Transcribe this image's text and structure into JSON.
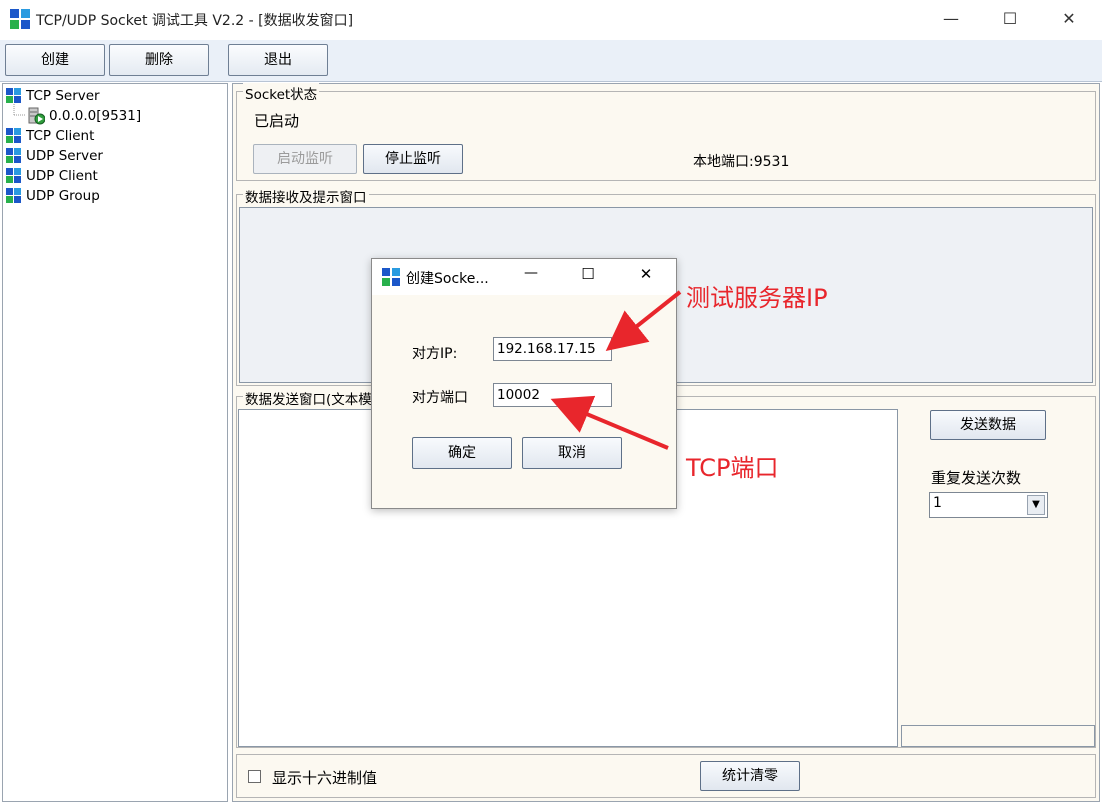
{
  "window": {
    "title": "TCP/UDP Socket 调试工具 V2.2 - [数据收发窗口]",
    "minimize_label": "—",
    "maximize_label": "☐",
    "close_label": "✕"
  },
  "toolbar": {
    "create_label": "创建",
    "delete_label": "删除",
    "exit_label": "退出"
  },
  "tree": {
    "items": [
      {
        "label": "TCP Server"
      },
      {
        "label": "0.0.0.0[9531]"
      },
      {
        "label": "TCP Client"
      },
      {
        "label": "UDP Server"
      },
      {
        "label": "UDP Client"
      },
      {
        "label": "UDP Group"
      }
    ]
  },
  "socket_status": {
    "legend": "Socket状态",
    "status_text": "已启动",
    "start_listen_label": "启动监听",
    "stop_listen_label": "停止监听",
    "local_port_text": "本地端口:9531"
  },
  "receive": {
    "legend": "数据接收及提示窗口"
  },
  "send": {
    "legend": "数据发送窗口(文本模",
    "send_button_label": "发送数据",
    "repeat_label": "重复发送次数",
    "repeat_value": "1"
  },
  "bottom": {
    "hex_label": "显示十六进制值",
    "clear_stats_label": "统计清零"
  },
  "dialog": {
    "title": "创建Socke...",
    "minimize_label": "—",
    "maximize_label": "☐",
    "close_label": "✕",
    "ip_label": "对方IP:",
    "ip_value": "192.168.17.15",
    "port_label": "对方端口",
    "port_value": "10002",
    "ok_label": "确定",
    "cancel_label": "取消"
  },
  "annotations": {
    "server_ip": "测试服务器IP",
    "tcp_port": "TCP端口"
  },
  "colors": {
    "annotation": "#e8262c",
    "panel_bg": "#fcf9f1",
    "toolbar_bg": "#eaf0f8"
  }
}
